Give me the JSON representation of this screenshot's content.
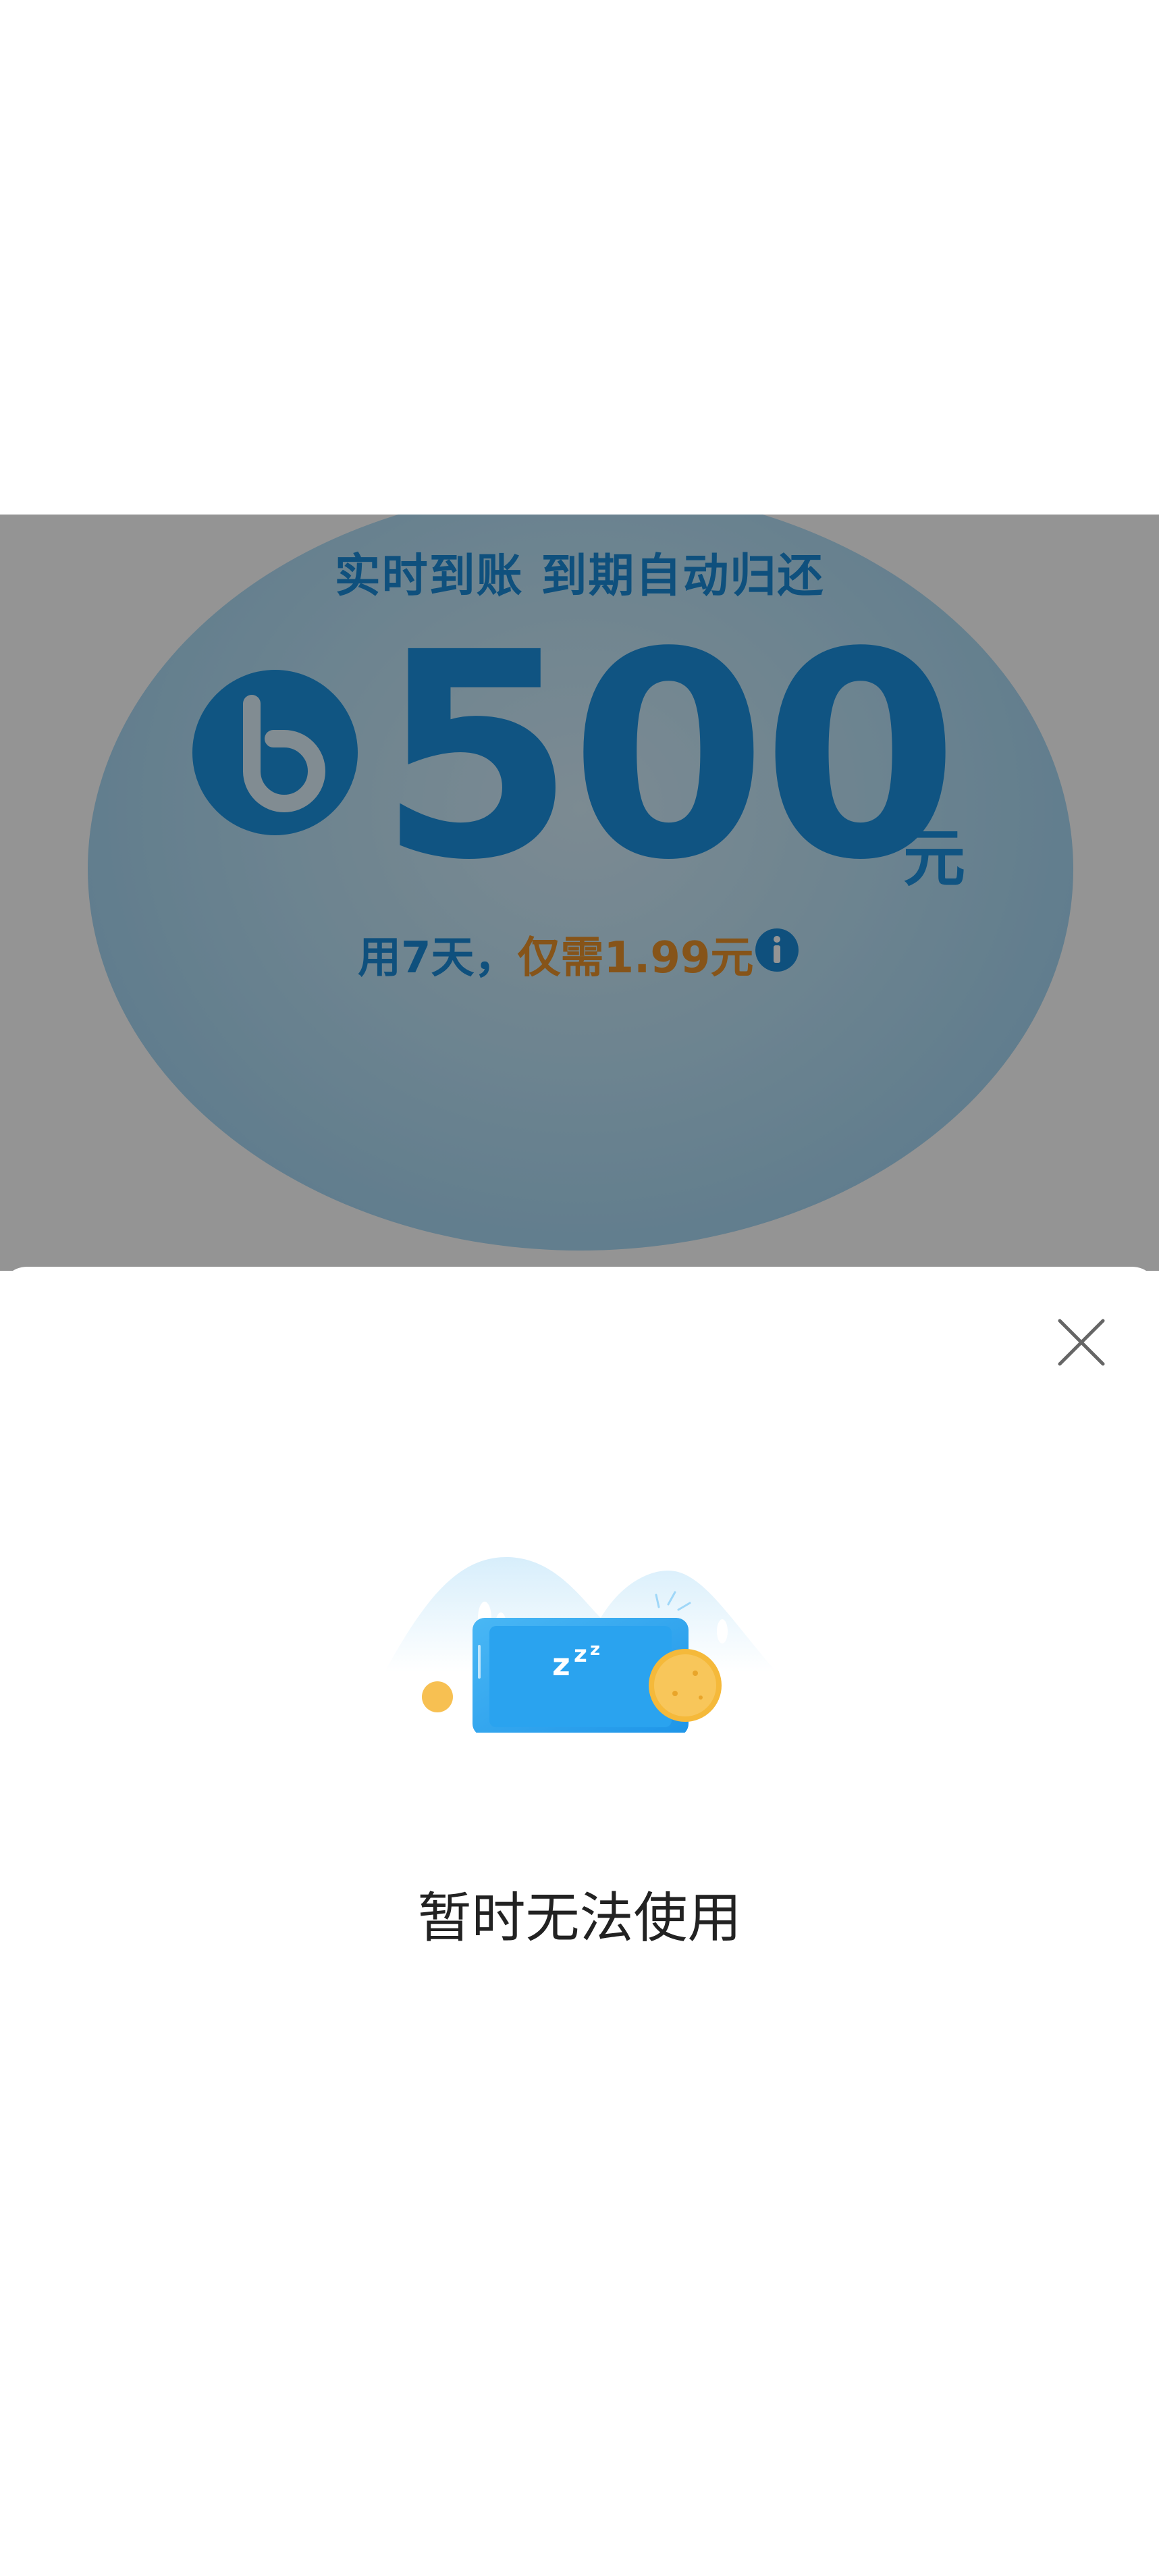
{
  "promo": {
    "subtitle": "实时到账 到期自动归还",
    "amount": "500",
    "amount_unit": "元",
    "cost_prefix": "用7天，",
    "cost_highlight": "仅需1.99元",
    "brand_icon": "b-logo-icon",
    "info_icon": "info-icon"
  },
  "sheet": {
    "close_icon": "close-icon",
    "illustration": "sleeping-phone-illustration",
    "message": "暂时无法使用"
  },
  "colors": {
    "accent_blue": "#1d92e0",
    "highlight_orange": "#e7922b",
    "overlay": "rgba(0,0,0,0.42)"
  }
}
